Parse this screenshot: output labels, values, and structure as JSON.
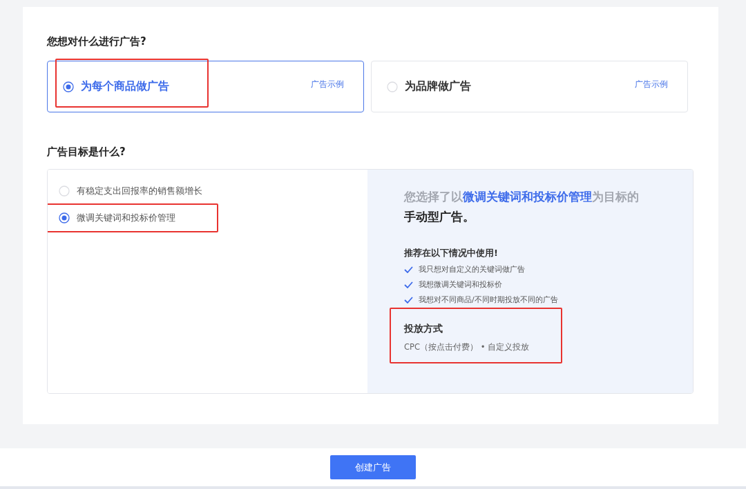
{
  "ad_type_section": {
    "heading": "您想对什么进行广告?",
    "options": [
      {
        "label": "为每个商品做广告",
        "link": "广告示例",
        "selected": true,
        "annotated": true
      },
      {
        "label": "为品牌做广告",
        "link": "广告示例",
        "selected": false,
        "annotated": false
      }
    ]
  },
  "goal_section": {
    "heading": "广告目标是什么?",
    "options": [
      {
        "label": "有稳定支出回报率的销售额增长",
        "selected": false,
        "annotated": false
      },
      {
        "label": "微调关键词和投标价管理",
        "selected": true,
        "annotated": true
      }
    ],
    "summary": {
      "line_1": "您选择了以**微调关键词和投标价管理**为目标的",
      "line_2": "手动型广告。"
    },
    "recommend_heading": "推荐在以下情况中使用!",
    "recommendations": [
      "我只想对自定义的关键词做广告",
      "我想微调关键词和投标价",
      "我想对不同商品/不同时期投放不同的广告"
    ],
    "delivery": {
      "heading": "投放方式",
      "value": "CPC（按点击付费） • 自定义投放",
      "annotated": true
    }
  },
  "footer": {
    "button": "创建广告"
  }
}
